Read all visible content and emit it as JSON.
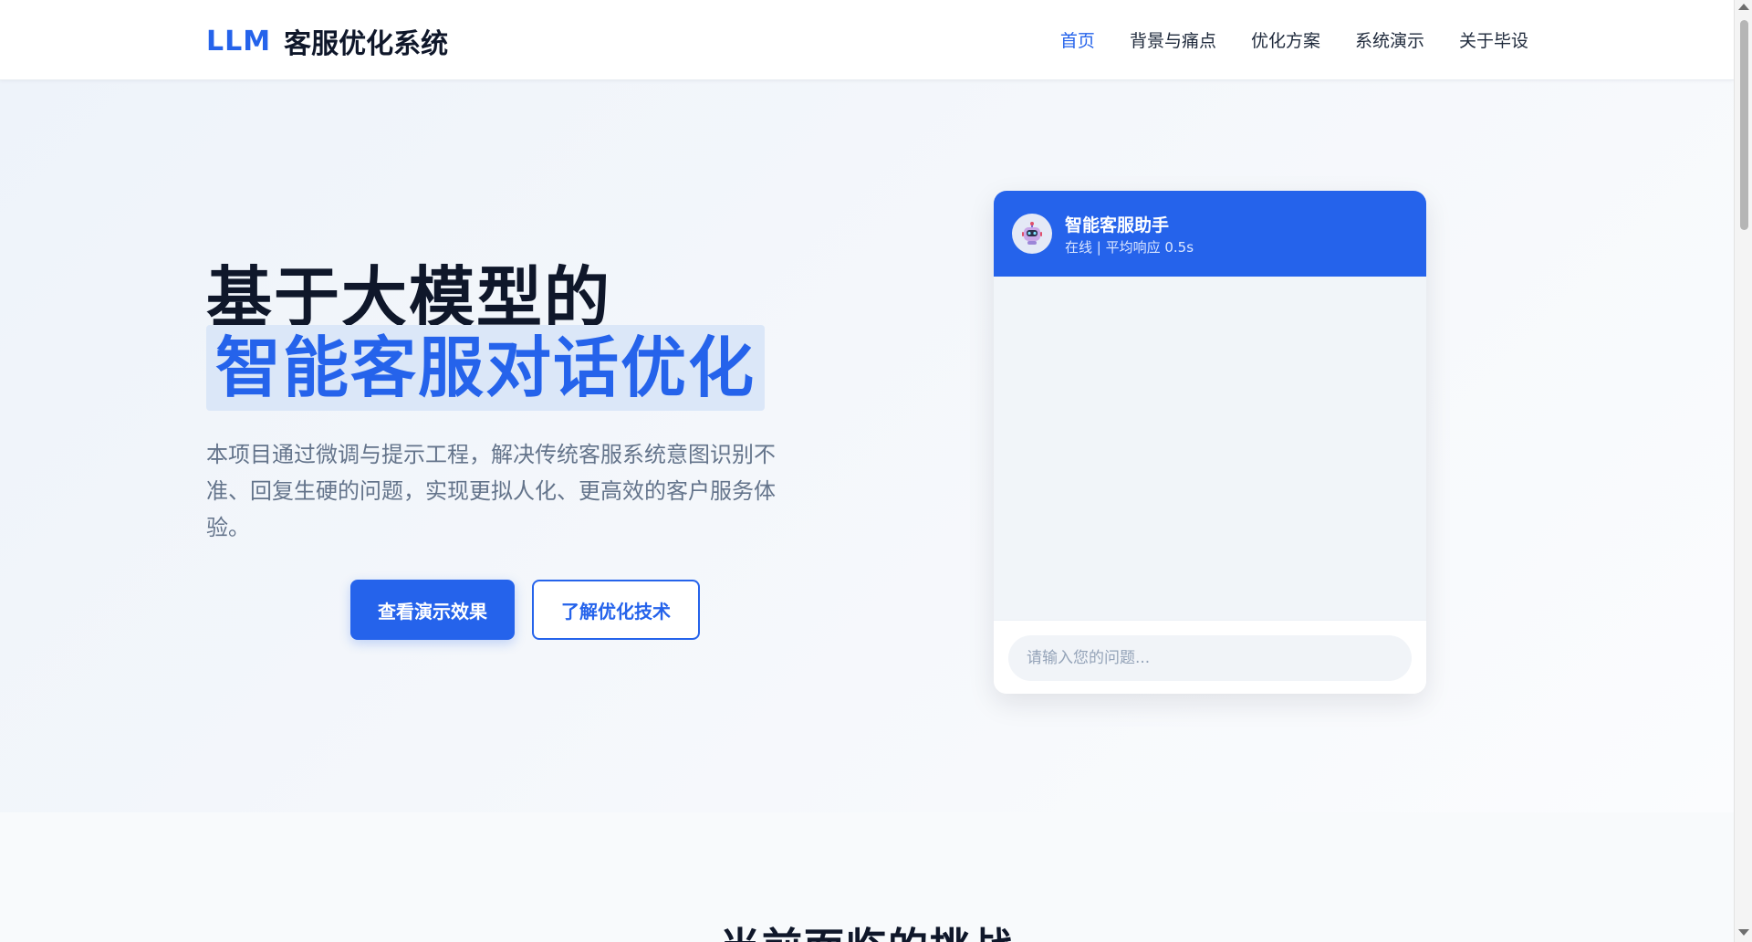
{
  "header": {
    "logo_brand": "LLM",
    "logo_text": "客服优化系统",
    "nav": [
      {
        "label": "首页",
        "active": true
      },
      {
        "label": "背景与痛点",
        "active": false
      },
      {
        "label": "优化方案",
        "active": false
      },
      {
        "label": "系统演示",
        "active": false
      },
      {
        "label": "关于毕设",
        "active": false
      }
    ]
  },
  "hero": {
    "title_line1": "基于大模型的",
    "title_line2": "智能客服对话优化",
    "description": "本项目通过微调与提示工程，解决传统客服系统意图识别不准、回复生硬的问题，实现更拟人化、更高效的客户服务体验。",
    "primary_button": "查看演示效果",
    "secondary_button": "了解优化技术"
  },
  "chat": {
    "assistant_name": "智能客服助手",
    "status": "在线 | 平均响应 0.5s",
    "avatar_icon": "robot-icon",
    "input_placeholder": "请输入您的问题..."
  },
  "section2": {
    "title": "当前面临的挑战"
  },
  "colors": {
    "accent": "#2563eb",
    "text_dark": "#0f172a",
    "text_muted": "#64748b",
    "highlight_bg": "#dbe7f8"
  }
}
